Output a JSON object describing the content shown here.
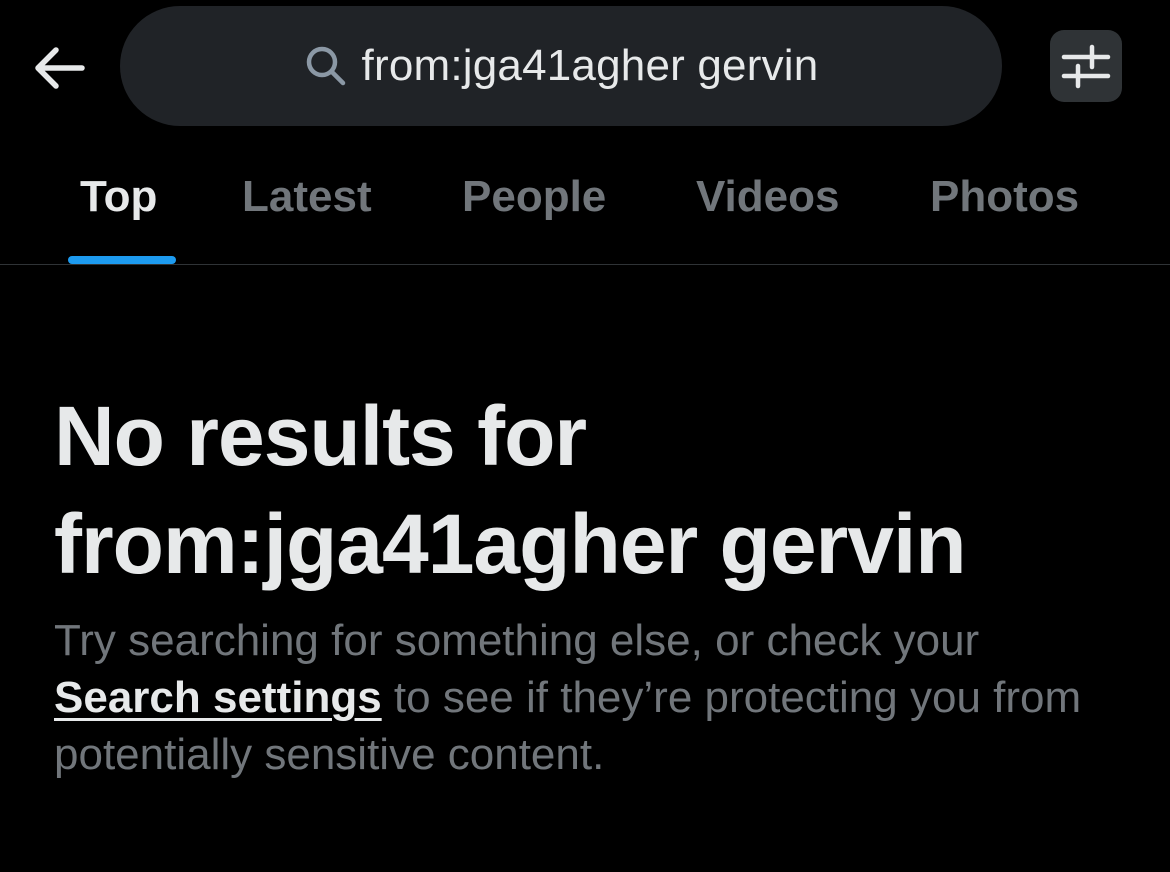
{
  "header": {
    "back_icon": "arrow-left-icon",
    "search": {
      "icon": "search-icon",
      "query": "from:jga41agher gervin"
    },
    "filter_icon": "sliders-icon"
  },
  "tabs": [
    {
      "label": "Top",
      "active": true
    },
    {
      "label": "Latest",
      "active": false
    },
    {
      "label": "People",
      "active": false
    },
    {
      "label": "Videos",
      "active": false
    },
    {
      "label": "Photos",
      "active": false
    }
  ],
  "empty_state": {
    "title_line1": "No results for",
    "title_line2": "from:jga41agher gervin",
    "body_before": "Try searching for something else, or check your ",
    "body_link": "Search settings",
    "body_after": " to see if they’re protecting you from potentially sensitive content."
  },
  "colors": {
    "background": "#000000",
    "primary_text": "#e7e9ea",
    "secondary_text": "#71767b",
    "accent": "#1d9bf0",
    "search_bg": "#202327"
  }
}
